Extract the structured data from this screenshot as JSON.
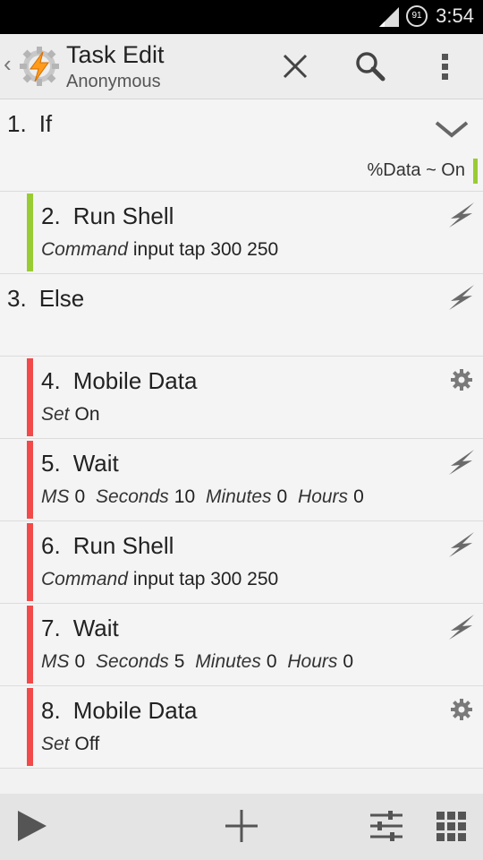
{
  "status_bar": {
    "battery": "91",
    "time": "3:54"
  },
  "action_bar": {
    "title": "Task Edit",
    "subtitle": "Anonymous"
  },
  "condition": {
    "text": "%Data ~ On"
  },
  "actions": [
    {
      "num": "1.",
      "title": "If"
    },
    {
      "num": "2.",
      "title": "Run Shell",
      "params": [
        {
          "k": "Command",
          "v": "input tap 300 250"
        }
      ]
    },
    {
      "num": "3.",
      "title": "Else"
    },
    {
      "num": "4.",
      "title": "Mobile Data",
      "params": [
        {
          "k": "Set",
          "v": "On"
        }
      ]
    },
    {
      "num": "5.",
      "title": "Wait",
      "params": [
        {
          "k": "MS",
          "v": "0"
        },
        {
          "k": "Seconds",
          "v": "10"
        },
        {
          "k": "Minutes",
          "v": "0"
        },
        {
          "k": "Hours",
          "v": "0"
        }
      ]
    },
    {
      "num": "6.",
      "title": "Run Shell",
      "params": [
        {
          "k": "Command",
          "v": "input tap 300 250"
        }
      ]
    },
    {
      "num": "7.",
      "title": "Wait",
      "params": [
        {
          "k": "MS",
          "v": "0"
        },
        {
          "k": "Seconds",
          "v": "5"
        },
        {
          "k": "Minutes",
          "v": "0"
        },
        {
          "k": "Hours",
          "v": "0"
        }
      ]
    },
    {
      "num": "8.",
      "title": "Mobile Data",
      "params": [
        {
          "k": "Set",
          "v": "Off"
        }
      ]
    }
  ],
  "icons": {
    "collapse": "chevron-down-icon",
    "shell": "lightning-icon",
    "setting": "gear-icon",
    "close": "close-icon",
    "search": "search-icon",
    "overflow": "overflow-menu-icon",
    "play": "play-icon",
    "add": "plus-icon",
    "properties": "sliders-icon",
    "grid": "grid-icon"
  },
  "colors": {
    "if_branch": "#99cc33",
    "else_branch": "#f24a4a",
    "background": "#f2f2f2"
  }
}
